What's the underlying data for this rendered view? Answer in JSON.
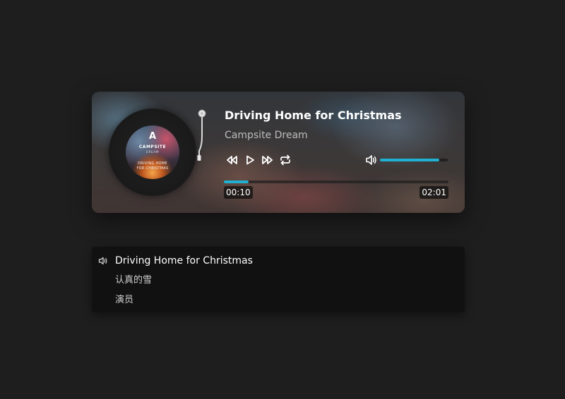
{
  "player": {
    "title": "Driving Home for Christmas",
    "artist": "Campsite Dream",
    "current_time": "00:10",
    "total_time": "02:01",
    "progress": 0.11,
    "volume": 0.88,
    "accent_color": "#20b0d2",
    "controls": {
      "prev_icon": "rewind-icon",
      "play_icon": "play-icon",
      "next_icon": "fast-forward-icon",
      "loop_icon": "repeat-icon",
      "volume_icon": "speaker-icon"
    },
    "cover": {
      "logo": "A",
      "brand": "CAMPSITE",
      "brand_sub": "DREAM",
      "line1": "DRIVING HOME",
      "line2": "FOR CHRISTMAS"
    }
  },
  "playlist": {
    "items": [
      {
        "label": "Driving Home for Christmas",
        "active": true
      },
      {
        "label": "认真的雪",
        "active": false
      },
      {
        "label": "演员",
        "active": false
      }
    ]
  }
}
